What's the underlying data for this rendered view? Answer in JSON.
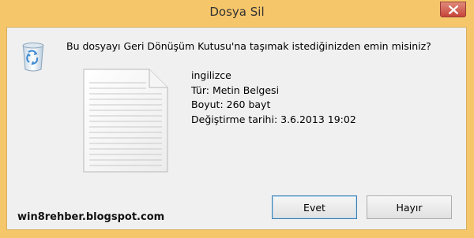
{
  "window": {
    "title": "Dosya Sil"
  },
  "dialog": {
    "question": "Bu dosyayı Geri Dönüşüm Kutusu'na taşımak istediğinizden emin misiniz?",
    "file": {
      "name": "ingilizce",
      "type": "Tür: Metin Belgesi",
      "size": "Boyut: 260 bayt",
      "modified": "Değiştirme tarihi: 3.6.2013 19:02"
    },
    "buttons": {
      "yes": "Evet",
      "no": "Hayır"
    },
    "watermark": "win8rehber.blogspot.com"
  },
  "icons": {
    "recycle_bin": "recycle-bin-icon",
    "document": "text-document-icon",
    "close": "close-icon"
  },
  "colors": {
    "titlebar": "#f6c66a",
    "client": "#f0f0f0",
    "close_button": "#c7443a",
    "default_button_border": "#3c7fb1"
  }
}
